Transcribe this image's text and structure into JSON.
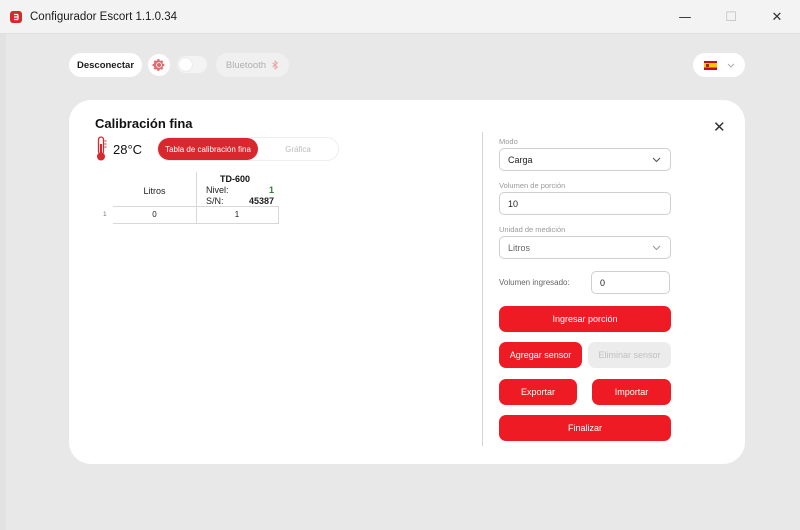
{
  "window": {
    "title": "Configurador Escort 1.1.0.34",
    "controls": {
      "minimize": "—",
      "maximize": "☐",
      "close": "✕"
    }
  },
  "toolbar": {
    "disconnect_label": "Desconectar",
    "settings_icon": "gear-icon",
    "bluetooth_label": "Bluetooth",
    "language": "es"
  },
  "modal": {
    "title": "Calibración fina",
    "close": "✕",
    "temperature": "28°C",
    "tabs": [
      {
        "label": "Tabla de calibración fina",
        "active": true
      },
      {
        "label": "Gráfica",
        "active": false
      }
    ],
    "table": {
      "litros_header": "Litros",
      "sensor": {
        "name": "TD-600",
        "nivel_label": "Nivel:",
        "nivel_value": "1",
        "sn_label": "S/N:",
        "sn_value": "45387"
      },
      "rows": [
        {
          "index": "1",
          "litros": "0",
          "nivel": "1"
        }
      ]
    },
    "form": {
      "modo_label": "Modo",
      "modo_value": "Carga",
      "volumen_porcion_label": "Volumen de porción",
      "volumen_porcion_value": "10",
      "unidad_label": "Unidad de medición",
      "unidad_value": "Litros",
      "volumen_ingresado_label": "Volumen ingresado:",
      "volumen_ingresado_value": "0"
    },
    "buttons": {
      "ingresar": "Ingresar porción",
      "agregar": "Agregar sensor",
      "eliminar": "Eliminar sensor",
      "exportar": "Exportar",
      "importar": "Importar",
      "finalizar": "Finalizar"
    }
  },
  "colors": {
    "accent": "#ee1b24",
    "brand": "#d9272e"
  }
}
